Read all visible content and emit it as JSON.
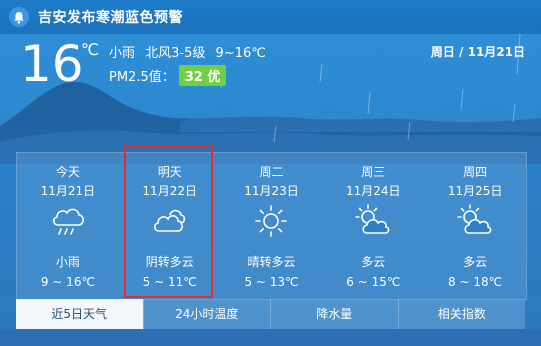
{
  "alert": {
    "icon": "bell-icon",
    "text": "吉安发布寒潮蓝色预警"
  },
  "current": {
    "temperature": "16",
    "unit": "℃",
    "condition": "小雨",
    "wind": "北风3-5级",
    "range": "9~16℃",
    "pm_label": "PM2.5值：",
    "pm_value": "32 优",
    "pm_color": "#70cf42",
    "date": "周日 / 11月21日"
  },
  "forecast": [
    {
      "name": "今天",
      "date": "11月21日",
      "icon": "rain-cloud-icon",
      "condition": "小雨",
      "range": "9 ~ 16℃"
    },
    {
      "name": "明天",
      "date": "11月22日",
      "icon": "cloudy-icon",
      "condition": "阴转多云",
      "range": "5 ~ 11℃"
    },
    {
      "name": "周二",
      "date": "11月23日",
      "icon": "sun-icon",
      "condition": "晴转多云",
      "range": "5 ~ 13℃"
    },
    {
      "name": "周三",
      "date": "11月24日",
      "icon": "partly-cloudy-icon",
      "condition": "多云",
      "range": "6 ~ 15℃"
    },
    {
      "name": "周四",
      "date": "11月25日",
      "icon": "partly-cloudy-icon",
      "condition": "多云",
      "range": "8 ~ 18℃"
    }
  ],
  "tabs": [
    {
      "label": "近5日天气",
      "active": true
    },
    {
      "label": "24小时温度",
      "active": false
    },
    {
      "label": "降水量",
      "active": false
    },
    {
      "label": "相关指数",
      "active": false
    }
  ],
  "highlight_color": "#e23030"
}
